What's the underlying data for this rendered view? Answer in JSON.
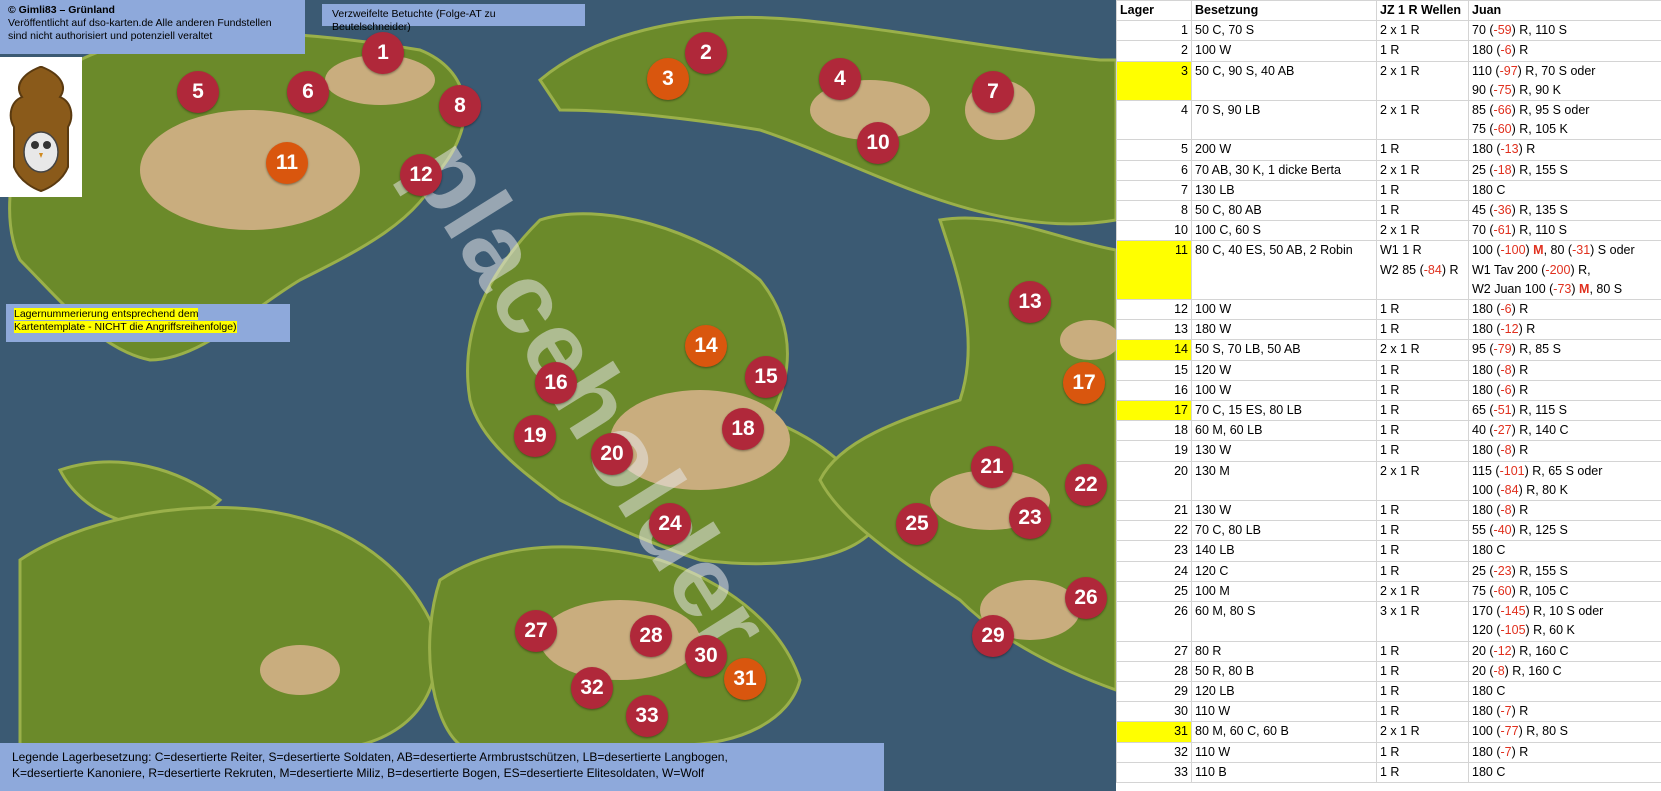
{
  "credit": {
    "line1": "© Gimli83 – Grünland",
    "line2": "Veröffentlicht auf dso-karten.de Alle anderen Fundstellen",
    "line3": "sind nicht authorisiert und potenziell veraltet"
  },
  "subtitle": "Verzweifelte Betuchte (Folge-AT zu Beutelschneider)",
  "lager_note": {
    "line1": "Lagernummerierung entsprechend dem",
    "line2": "Kartentemplate - NICHT die Angriffsreihenfolge)"
  },
  "watermark": "placeholder",
  "legend": {
    "line1": "Legende Lagerbesetzung: C=desertierte Reiter, S=desertierte Soldaten, AB=desertierte Armbrustschützen, LB=desertierte Langbogen,",
    "line2": "K=desertierte Kanoniere, R=desertierte Rekruten, M=desertierte Miliz, B=desertierte Bogen, ES=desertierte Elitesoldaten, W=Wolf"
  },
  "colors": {
    "marker_red": "#b0283a",
    "marker_orange": "#d9560e",
    "label_bg": "#8ea9db",
    "highlight": "#ffff00",
    "negative": "#e0301e",
    "water": "#3b5a73",
    "land": "#6b8a2a",
    "sand": "#c9ad7e"
  },
  "markers": [
    {
      "n": "1",
      "c": "red"
    },
    {
      "n": "2",
      "c": "red"
    },
    {
      "n": "3",
      "c": "orange"
    },
    {
      "n": "4",
      "c": "red"
    },
    {
      "n": "5",
      "c": "red"
    },
    {
      "n": "6",
      "c": "red"
    },
    {
      "n": "7",
      "c": "red"
    },
    {
      "n": "8",
      "c": "red"
    },
    {
      "n": "10",
      "c": "red"
    },
    {
      "n": "11",
      "c": "orange"
    },
    {
      "n": "12",
      "c": "red"
    },
    {
      "n": "13",
      "c": "red"
    },
    {
      "n": "14",
      "c": "orange"
    },
    {
      "n": "15",
      "c": "red"
    },
    {
      "n": "16",
      "c": "red"
    },
    {
      "n": "17",
      "c": "orange"
    },
    {
      "n": "18",
      "c": "red"
    },
    {
      "n": "19",
      "c": "red"
    },
    {
      "n": "20",
      "c": "red"
    },
    {
      "n": "21",
      "c": "red"
    },
    {
      "n": "22",
      "c": "red"
    },
    {
      "n": "23",
      "c": "red"
    },
    {
      "n": "24",
      "c": "red"
    },
    {
      "n": "25",
      "c": "red"
    },
    {
      "n": "26",
      "c": "red"
    },
    {
      "n": "27",
      "c": "red"
    },
    {
      "n": "28",
      "c": "red"
    },
    {
      "n": "29",
      "c": "red"
    },
    {
      "n": "30",
      "c": "red"
    },
    {
      "n": "31",
      "c": "orange"
    },
    {
      "n": "32",
      "c": "red"
    },
    {
      "n": "33",
      "c": "red"
    }
  ],
  "table": {
    "headers": [
      "Lager",
      "Besetzung",
      "JZ 1 R Wellen",
      "Juan"
    ],
    "rows": [
      {
        "lager": "1",
        "hl": false,
        "besetzung": "50 C, 70 S",
        "wellen": [
          "2 x 1 R"
        ],
        "juan": [
          [
            "70 (",
            "-59",
            ") R, 110 S"
          ]
        ]
      },
      {
        "lager": "2",
        "hl": false,
        "besetzung": "100 W",
        "wellen": [
          "1 R"
        ],
        "juan": [
          [
            "180 (",
            "-6",
            ") R"
          ]
        ]
      },
      {
        "lager": "3",
        "hl": true,
        "besetzung": "50 C, 90 S, 40 AB",
        "wellen": [
          "2 x 1 R"
        ],
        "juan": [
          [
            "110 (",
            "-97",
            ") R, 70 S oder"
          ],
          [
            "90 (",
            "-75",
            ") R, 90 K"
          ]
        ]
      },
      {
        "lager": "4",
        "hl": false,
        "besetzung": "70 S, 90 LB",
        "wellen": [
          "2 x 1 R"
        ],
        "juan": [
          [
            "85 (",
            "-66",
            ") R, 95 S oder"
          ],
          [
            "75 (",
            "-60",
            ") R, 105 K"
          ]
        ]
      },
      {
        "lager": "5",
        "hl": false,
        "besetzung": "200 W",
        "wellen": [
          "1 R"
        ],
        "juan": [
          [
            "180 (",
            "-13",
            ") R"
          ]
        ]
      },
      {
        "lager": "6",
        "hl": false,
        "besetzung": "70 AB, 30 K, 1 dicke Berta",
        "wellen": [
          "2 x 1 R"
        ],
        "juan": [
          [
            "25 (",
            "-18",
            ") R, 155 S"
          ]
        ]
      },
      {
        "lager": "7",
        "hl": false,
        "besetzung": "130 LB",
        "wellen": [
          "1 R"
        ],
        "juan": [
          [
            "180 C",
            "",
            ""
          ]
        ]
      },
      {
        "lager": "8",
        "hl": false,
        "besetzung": "50 C, 80 AB",
        "wellen": [
          "1 R"
        ],
        "juan": [
          [
            "45 (",
            "-36",
            ") R, 135 S"
          ]
        ]
      },
      {
        "lager": "10",
        "hl": false,
        "besetzung": "100 C, 60 S",
        "wellen": [
          "2 x 1 R"
        ],
        "juan": [
          [
            "70 (",
            "-61",
            ") R, 110 S"
          ]
        ]
      },
      {
        "lager": "11",
        "hl": true,
        "besetzung": "80 C, 40 ES, 50 AB, 2 Robin",
        "wellen": [
          "W1 1 R",
          "W2 85 (-84) R"
        ],
        "juan": [
          [
            "100 (",
            "-100",
            ") ",
            "M",
            ", 80 (",
            "-31",
            ") S oder"
          ],
          [
            "W1 Tav 200 (",
            "-200",
            ") R,"
          ],
          [
            "W2 Juan 100 (",
            "-73",
            ") ",
            "M",
            ", 80 S"
          ]
        ]
      },
      {
        "lager": "12",
        "hl": false,
        "besetzung": "100 W",
        "wellen": [
          "1 R"
        ],
        "juan": [
          [
            "180 (",
            "-6",
            ") R"
          ]
        ]
      },
      {
        "lager": "13",
        "hl": false,
        "besetzung": "180 W",
        "wellen": [
          "1 R"
        ],
        "juan": [
          [
            "180 (",
            "-12",
            ") R"
          ]
        ]
      },
      {
        "lager": "14",
        "hl": true,
        "besetzung": "50 S, 70 LB, 50 AB",
        "wellen": [
          "2 x 1 R"
        ],
        "juan": [
          [
            "95 (",
            "-79",
            ") R, 85 S"
          ]
        ]
      },
      {
        "lager": "15",
        "hl": false,
        "besetzung": "120 W",
        "wellen": [
          "1 R"
        ],
        "juan": [
          [
            "180 (",
            "-8",
            ") R"
          ]
        ]
      },
      {
        "lager": "16",
        "hl": false,
        "besetzung": "100 W",
        "wellen": [
          "1 R"
        ],
        "juan": [
          [
            "180 (",
            "-6",
            ") R"
          ]
        ]
      },
      {
        "lager": "17",
        "hl": true,
        "besetzung": "70 C, 15 ES, 80 LB",
        "wellen": [
          "1 R"
        ],
        "juan": [
          [
            "65 (",
            "-51",
            ") R, 115 S"
          ]
        ]
      },
      {
        "lager": "18",
        "hl": false,
        "besetzung": "60 M, 60 LB",
        "wellen": [
          "1 R"
        ],
        "juan": [
          [
            "40 (",
            "-27",
            ") R, 140 C"
          ]
        ]
      },
      {
        "lager": "19",
        "hl": false,
        "besetzung": "130 W",
        "wellen": [
          "1 R"
        ],
        "juan": [
          [
            "180 (",
            "-8",
            ") R"
          ]
        ]
      },
      {
        "lager": "20",
        "hl": false,
        "besetzung": "130 M",
        "wellen": [
          "2 x 1 R"
        ],
        "juan": [
          [
            "115 (",
            "-101",
            ") R, 65 S oder"
          ],
          [
            "100 (",
            "-84",
            ") R, 80 K"
          ]
        ]
      },
      {
        "lager": "21",
        "hl": false,
        "besetzung": "130 W",
        "wellen": [
          "1 R"
        ],
        "juan": [
          [
            "180 (",
            "-8",
            ") R"
          ]
        ]
      },
      {
        "lager": "22",
        "hl": false,
        "besetzung": "70 C, 80 LB",
        "wellen": [
          "1 R"
        ],
        "juan": [
          [
            "55 (",
            "-40",
            ") R, 125 S"
          ]
        ]
      },
      {
        "lager": "23",
        "hl": false,
        "besetzung": "140 LB",
        "wellen": [
          "1 R"
        ],
        "juan": [
          [
            "180 C",
            "",
            ""
          ]
        ]
      },
      {
        "lager": "24",
        "hl": false,
        "besetzung": "120 C",
        "wellen": [
          "1 R"
        ],
        "juan": [
          [
            "25 (",
            "-23",
            ") R, 155 S"
          ]
        ]
      },
      {
        "lager": "25",
        "hl": false,
        "besetzung": "100 M",
        "wellen": [
          "2 x 1 R"
        ],
        "juan": [
          [
            "75 (",
            "-60",
            ") R, 105 C"
          ]
        ]
      },
      {
        "lager": "26",
        "hl": false,
        "besetzung": "60 M, 80 S",
        "wellen": [
          "3 x 1 R"
        ],
        "juan": [
          [
            "170 (",
            "-145",
            ") R, 10 S oder"
          ],
          [
            "120 (",
            "-105",
            ") R, 60 K"
          ]
        ]
      },
      {
        "lager": "27",
        "hl": false,
        "besetzung": "80 R",
        "wellen": [
          "1 R"
        ],
        "juan": [
          [
            "20 (",
            "-12",
            ") R, 160 C"
          ]
        ]
      },
      {
        "lager": "28",
        "hl": false,
        "besetzung": "50 R, 80 B",
        "wellen": [
          "1 R"
        ],
        "juan": [
          [
            "20 (",
            "-8",
            ") R, 160 C"
          ]
        ]
      },
      {
        "lager": "29",
        "hl": false,
        "besetzung": "120 LB",
        "wellen": [
          "1 R"
        ],
        "juan": [
          [
            "180 C",
            "",
            ""
          ]
        ]
      },
      {
        "lager": "30",
        "hl": false,
        "besetzung": "110 W",
        "wellen": [
          "1 R"
        ],
        "juan": [
          [
            "180 (",
            "-7",
            ") R"
          ]
        ]
      },
      {
        "lager": "31",
        "hl": true,
        "besetzung": "80 M, 60 C, 60 B",
        "wellen": [
          "2 x 1 R"
        ],
        "juan": [
          [
            "100 (",
            "-77",
            ") R, 80 S"
          ]
        ]
      },
      {
        "lager": "32",
        "hl": false,
        "besetzung": "110 W",
        "wellen": [
          "1 R"
        ],
        "juan": [
          [
            "180 (",
            "-7",
            ") R"
          ]
        ]
      },
      {
        "lager": "33",
        "hl": false,
        "besetzung": "110 B",
        "wellen": [
          "1 R"
        ],
        "juan": [
          [
            "180 C",
            "",
            ""
          ]
        ]
      }
    ]
  }
}
